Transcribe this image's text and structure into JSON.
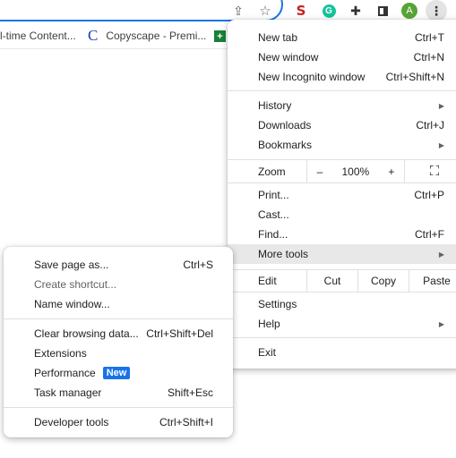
{
  "toolbar": {
    "icons": [
      "share-icon",
      "bookmark-star-icon",
      "seo-extension-icon",
      "grammarly-extension-icon",
      "extensions-puzzle-icon",
      "side-panel-icon",
      "profile-avatar",
      "more-menu-icon"
    ],
    "seo_ext_glyph": "S",
    "grammarly_glyph": "G",
    "avatar_letter": "A",
    "kebab_glyph": "⋮",
    "share_glyph": "⇪",
    "star_glyph": "☆",
    "puzzle_glyph": "✚"
  },
  "bookmarks": [
    {
      "label": "l-time Content..."
    },
    {
      "icon_glyph": "C",
      "label": "Copyscape - Premi..."
    },
    {
      "icon_glyph": "+",
      "label": ""
    }
  ],
  "main_menu": {
    "new_tab": {
      "label": "New tab",
      "accel": "Ctrl+T"
    },
    "new_window": {
      "label": "New window",
      "accel": "Ctrl+N"
    },
    "new_incognito": {
      "label": "New Incognito window",
      "accel": "Ctrl+Shift+N"
    },
    "history": {
      "label": "History",
      "arrow": "▶"
    },
    "downloads": {
      "label": "Downloads",
      "accel": "Ctrl+J"
    },
    "bookmarks": {
      "label": "Bookmarks",
      "arrow": "▶"
    },
    "zoom": {
      "label": "Zoom",
      "minus": "–",
      "value": "100%",
      "plus": "+",
      "fullscreen": "⛶"
    },
    "print": {
      "label": "Print...",
      "accel": "Ctrl+P"
    },
    "cast": {
      "label": "Cast..."
    },
    "find": {
      "label": "Find...",
      "accel": "Ctrl+F"
    },
    "more_tools": {
      "label": "More tools",
      "arrow": "▶"
    },
    "edit": {
      "label": "Edit",
      "cut": "Cut",
      "copy": "Copy",
      "paste": "Paste"
    },
    "settings": {
      "label": "Settings"
    },
    "help": {
      "label": "Help",
      "arrow": "▶"
    },
    "exit": {
      "label": "Exit"
    }
  },
  "sub_menu": {
    "save_page": {
      "label": "Save page as...",
      "accel": "Ctrl+S"
    },
    "create_shortcut": {
      "label": "Create shortcut..."
    },
    "name_window": {
      "label": "Name window..."
    },
    "clear_browsing": {
      "label": "Clear browsing data...",
      "accel": "Ctrl+Shift+Del"
    },
    "extensions": {
      "label": "Extensions"
    },
    "performance": {
      "label": "Performance",
      "badge": "New"
    },
    "task_manager": {
      "label": "Task manager",
      "accel": "Shift+Esc"
    },
    "developer_tools": {
      "label": "Developer tools",
      "accel": "Ctrl+Shift+I"
    }
  }
}
